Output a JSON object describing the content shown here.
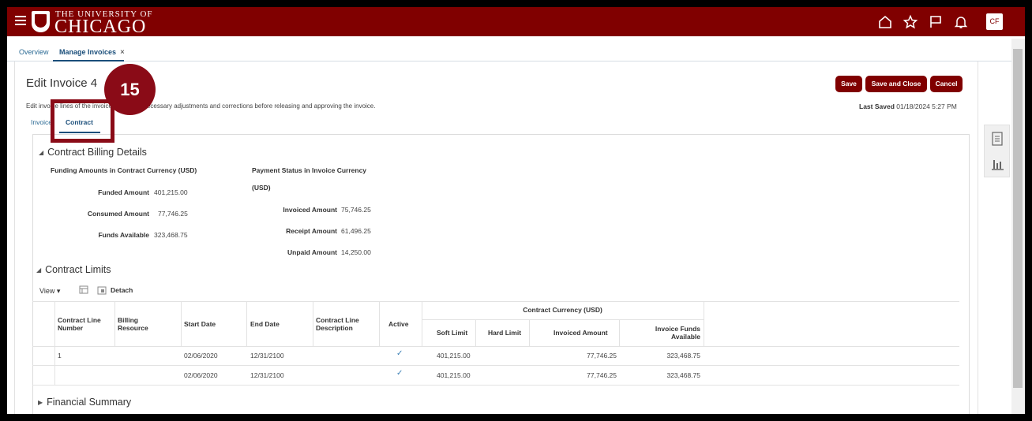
{
  "header": {
    "logo_top": "THE UNIVERSITY OF",
    "logo_main": "CHICAGO",
    "icons": [
      "home-icon",
      "star-icon",
      "flag-icon",
      "bell-icon"
    ],
    "avatar_initials": "CF",
    "brand_color": "#800000"
  },
  "page_tabs": [
    {
      "label": "Overview"
    },
    {
      "label": "Manage Invoices"
    }
  ],
  "page": {
    "title": "Edit Invoice 4",
    "subtitle": "Edit invoice lines of the invoice and make necessary adjustments and corrections before releasing and approving the invoice.",
    "buttons": {
      "save": "Save",
      "save_close": "Save and Close",
      "cancel": "Cancel"
    },
    "last_saved_label": "Last Saved",
    "last_saved_value": "01/18/2024 5:27 PM",
    "subtabs": [
      "Invoice",
      "Contract"
    ]
  },
  "callout": {
    "number": "15"
  },
  "billing": {
    "section": "Contract Billing Details",
    "funding_header": "Funding Amounts in Contract Currency (USD)",
    "payment_header_1": "Payment Status in Invoice Currency",
    "payment_header_2": "(USD)",
    "funded_label": "Funded Amount",
    "funded_value": "401,215.00",
    "consumed_label": "Consumed Amount",
    "consumed_value": "77,746.25",
    "available_label": "Funds Available",
    "available_value": "323,468.75",
    "invoiced_label": "Invoiced Amount",
    "invoiced_value": "75,746.25",
    "receipt_label": "Receipt Amount",
    "receipt_value": "61,496.25",
    "unpaid_label": "Unpaid Amount",
    "unpaid_value": "14,250.00"
  },
  "limits": {
    "section": "Contract Limits",
    "view_label": "View",
    "detach_label": "Detach",
    "group_header": "Contract Currency (USD)",
    "columns": {
      "line_1": "Contract Line",
      "line_2": "Number",
      "res_1": "Billing",
      "res_2": "Resource",
      "start": "Start Date",
      "end": "End Date",
      "desc_1": "Contract Line",
      "desc_2": "Description",
      "active": "Active",
      "soft": "Soft Limit",
      "hard": "Hard Limit",
      "invoiced": "Invoiced Amount",
      "funds_1": "Invoice Funds",
      "funds_2": "Available"
    },
    "rows": [
      {
        "line": "1",
        "start": "02/06/2020",
        "end": "12/31/2100",
        "active": "✓",
        "soft": "401,215.00",
        "invoiced": "77,746.25",
        "funds": "323,468.75"
      },
      {
        "line": "",
        "start": "02/06/2020",
        "end": "12/31/2100",
        "active": "✓",
        "soft": "401,215.00",
        "invoiced": "77,746.25",
        "funds": "323,468.75"
      }
    ]
  },
  "financial": {
    "section": "Financial Summary"
  }
}
